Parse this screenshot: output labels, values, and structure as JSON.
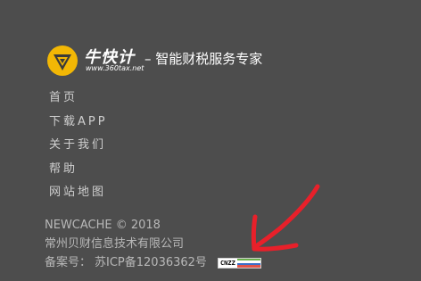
{
  "logo": {
    "brand_name": "牛快计",
    "url_text": "www.360tax.net",
    "slogan": "– 智能财税服务专家",
    "colors": {
      "gold": "#f2b705",
      "dark": "#3a3a3a"
    }
  },
  "nav": {
    "items": [
      {
        "label": "首页"
      },
      {
        "label": "下载APP"
      },
      {
        "label": "关于我们"
      },
      {
        "label": "帮助"
      },
      {
        "label": "网站地图"
      }
    ]
  },
  "footer": {
    "copyright": "NEWCACHE © 2018",
    "company": "常州贝财信息技术有限公司",
    "icp_label": "备案号：",
    "icp_number": "苏ICP备12036362号",
    "badge_text": "CNZZ"
  },
  "annotation": {
    "arrow_icon": "red-hand-drawn-arrow-icon",
    "arrow_color": "#e8202a"
  },
  "colors": {
    "background": "#4d4d4d",
    "text": "#cfcfcf",
    "white": "#ffffff"
  }
}
